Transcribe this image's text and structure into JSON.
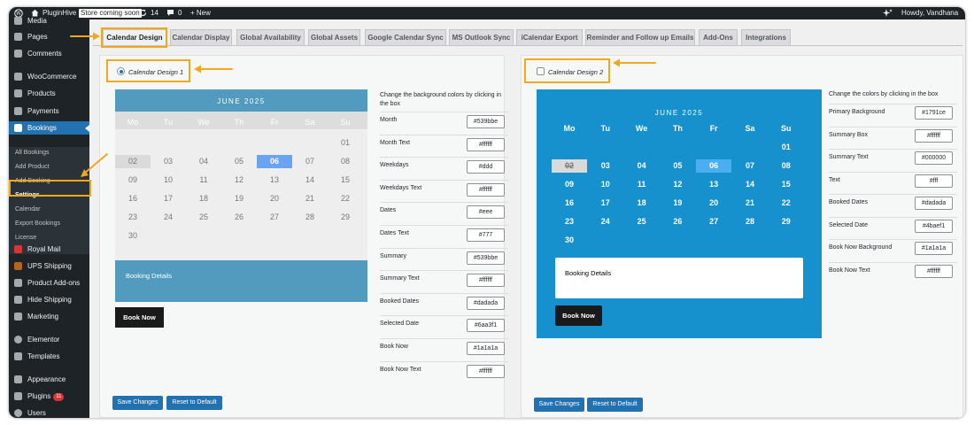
{
  "adminbar": {
    "site_name": "PluginHive",
    "store_badge": "Store coming soon",
    "updates_count": "14",
    "comments_count": "0",
    "new_label": "+ New",
    "greeting": "Howdy, Vandhana"
  },
  "sidebar": {
    "items": [
      "Media",
      "Pages",
      "Comments",
      "WooCommerce",
      "Products",
      "Payments",
      "Bookings",
      "Royal Mail",
      "UPS Shipping",
      "Product Add-ons",
      "Hide Shipping",
      "Marketing",
      "Elementor",
      "Templates",
      "Appearance",
      "Plugins",
      "Users"
    ],
    "plugins_badge": "11",
    "submenu": [
      "All Bookings",
      "Add Product",
      "Add Booking",
      "Settings",
      "Calendar",
      "Export Bookings",
      "License"
    ]
  },
  "tabs": [
    "Calendar Design",
    "Calendar Display",
    "Global Availability",
    "Global Assets",
    "Google Calendar Sync",
    "MS Outlook Sync",
    "iCalendar Export",
    "Reminder and Follow up Emails",
    "Add-Ons",
    "Integrations"
  ],
  "weekdays": [
    "Mo",
    "Tu",
    "We",
    "Th",
    "Fr",
    "Sa",
    "Su"
  ],
  "days": [
    "01",
    "02",
    "03",
    "04",
    "05",
    "06",
    "07",
    "08",
    "09",
    "10",
    "11",
    "12",
    "13",
    "14",
    "15",
    "16",
    "17",
    "18",
    "19",
    "20",
    "21",
    "22",
    "23",
    "24",
    "25",
    "26",
    "27",
    "28",
    "29",
    "30"
  ],
  "design1": {
    "option_label": "Calendar Design 1",
    "month_title": "JUNE 2025",
    "summary_label": "Booking Details",
    "book_now": "Book Now",
    "colors_heading": "Change the background colors by clicking in the box",
    "fields": [
      {
        "label": "Month",
        "value": "#539bbe"
      },
      {
        "label": "Month Text",
        "value": "#ffffff"
      },
      {
        "label": "Weekdays",
        "value": "#ddd"
      },
      {
        "label": "Weekdays Text",
        "value": "#ffffff"
      },
      {
        "label": "Dates",
        "value": "#eee"
      },
      {
        "label": "Dates Text",
        "value": "#777"
      },
      {
        "label": "Summary",
        "value": "#539bbe"
      },
      {
        "label": "Summary Text",
        "value": "#ffffff"
      },
      {
        "label": "Booked Dates",
        "value": "#dadada"
      },
      {
        "label": "Selected Date",
        "value": "#6aa3f1"
      },
      {
        "label": "Book Now",
        "value": "#1a1a1a"
      },
      {
        "label": "Book Now Text",
        "value": "#ffffff"
      }
    ],
    "save_label": "Save Changes",
    "reset_label": "Reset to Default"
  },
  "design2": {
    "option_label": "Calendar Design 2",
    "month_title": "JUNE 2025",
    "summary_label": "Booking Details",
    "book_now": "Book Now",
    "colors_heading": "Change the colors by clicking in the box",
    "fields": [
      {
        "label": "Primary Background",
        "value": "#1791ce"
      },
      {
        "label": "Summary Box",
        "value": "#ffffff"
      },
      {
        "label": "Summary Text",
        "value": "#000000"
      },
      {
        "label": "Text",
        "value": "#fff"
      },
      {
        "label": "Booked Dates",
        "value": "#dadada"
      },
      {
        "label": "Selected Date",
        "value": "#4baef1"
      },
      {
        "label": "Book Now Background",
        "value": "#1a1a1a"
      },
      {
        "label": "Book Now Text",
        "value": "#ffffff"
      }
    ],
    "save_label": "Save Changes",
    "reset_label": "Reset to Default"
  },
  "colors": {
    "admin_dark": "#1d2327",
    "admin_blue": "#2271b1",
    "highlight": "#f0a81e",
    "d1_month": "#539bbe",
    "d1_weekdays": "#dddddd",
    "d1_dates": "#eeeeee",
    "d1_booked": "#dadada",
    "d1_selected": "#6aa3f1",
    "d2_bg": "#1791ce",
    "d2_selected": "#4baef1"
  }
}
